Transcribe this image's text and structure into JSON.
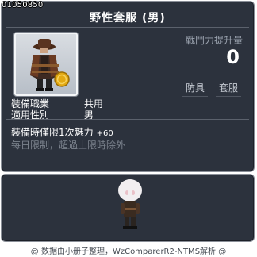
{
  "item": {
    "id": "01050850",
    "name": "野性套服 (男)"
  },
  "stats": {
    "power_label": "戰鬥力提升量",
    "power_value": "0"
  },
  "tags": [
    "防具",
    "套服"
  ],
  "info": [
    {
      "key": "裝備職業",
      "value": "共用"
    },
    {
      "key": "適用性別",
      "value": "男"
    }
  ],
  "description": {
    "line1": "裝備時僅限1次魅力",
    "line1_value": "+60",
    "line2": "每日限制，超過上限時除外"
  },
  "footer": "@ 数据由小册子整理，WzComparerR2-NTMS解析 @",
  "colors": {
    "panel": "#2c323d",
    "border": "#8a8f98",
    "muted_text": "#7c838e",
    "label_text": "#9aa2ae"
  }
}
